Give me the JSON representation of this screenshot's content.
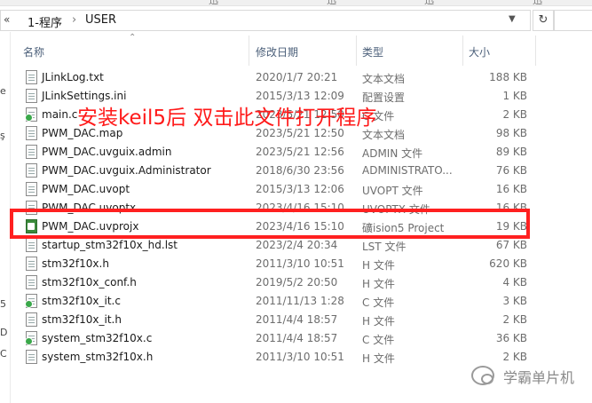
{
  "window": {
    "top_strip": [
      "迅",
      "迅",
      "迅",
      "迅"
    ]
  },
  "address_bar": {
    "overflow": "«",
    "crumbs": [
      "1-程序",
      "USER"
    ],
    "separator": "›"
  },
  "columns": {
    "name": "名称",
    "modified": "修改日期",
    "type": "类型",
    "size": "大小"
  },
  "files": [
    {
      "name": "JLinkLog.txt",
      "date": "2020/1/7 20:21",
      "type": "文本文档",
      "size": "188 KB",
      "icon": "text-file-icon"
    },
    {
      "name": "JLinkSettings.ini",
      "date": "2015/3/13 12:09",
      "type": "配置设置",
      "size": "1 KB",
      "icon": "settings-file-icon"
    },
    {
      "name": "main.c",
      "date": "2023/5/21 12:50",
      "type": "C 文件",
      "size": "2 KB",
      "icon": "c-file-icon"
    },
    {
      "name": "PWM_DAC.map",
      "date": "2023/5/21 12:50",
      "type": "文本文档",
      "size": "98 KB",
      "icon": "text-file-icon"
    },
    {
      "name": "PWM_DAC.uvguix.admin",
      "date": "2023/5/21 12:56",
      "type": "ADMIN 文件",
      "size": "89 KB",
      "icon": "generic-file-icon"
    },
    {
      "name": "PWM_DAC.uvguix.Administrator",
      "date": "2018/6/30 23:56",
      "type": "ADMINISTRATO...",
      "size": "76 KB",
      "icon": "generic-file-icon"
    },
    {
      "name": "PWM_DAC.uvopt",
      "date": "2015/3/13 12:06",
      "type": "UVOPT 文件",
      "size": "16 KB",
      "icon": "generic-file-icon"
    },
    {
      "name": "PWM_DAC.uvoptx",
      "date": "2023/4/16 15:10",
      "type": "UVOPTX 文件",
      "size": "16 KB",
      "icon": "generic-file-icon"
    },
    {
      "name": "PWM_DAC.uvprojx",
      "date": "2023/4/16 15:10",
      "type": "礦ision5 Project",
      "size": "19 KB",
      "icon": "keil-project-icon"
    },
    {
      "name": "startup_stm32f10x_hd.lst",
      "date": "2023/2/4 20:34",
      "type": "LST 文件",
      "size": "67 KB",
      "icon": "generic-file-icon"
    },
    {
      "name": "stm32f10x.h",
      "date": "2011/3/10 10:51",
      "type": "H 文件",
      "size": "620 KB",
      "icon": "h-file-icon"
    },
    {
      "name": "stm32f10x_conf.h",
      "date": "2019/5/2 20:50",
      "type": "H 文件",
      "size": "4 KB",
      "icon": "h-file-icon"
    },
    {
      "name": "stm32f10x_it.c",
      "date": "2011/11/13 1:28",
      "type": "C 文件",
      "size": "3 KB",
      "icon": "c-file-icon"
    },
    {
      "name": "stm32f10x_it.h",
      "date": "2011/4/4 18:57",
      "type": "H 文件",
      "size": "2 KB",
      "icon": "h-file-icon"
    },
    {
      "name": "system_stm32f10x.c",
      "date": "2011/4/4 18:57",
      "type": "C 文件",
      "size": "36 KB",
      "icon": "c-file-icon"
    },
    {
      "name": "system_stm32f10x.h",
      "date": "2011/3/10 10:51",
      "type": "H 文件",
      "size": "2 KB",
      "icon": "h-file-icon"
    }
  ],
  "annotation": {
    "text": "安装keil5后 双击此文件打开程序",
    "color": "#ff1a1a"
  },
  "highlight_color": "#ff2020",
  "nav_pane_glyphs": [
    "e",
    "ş",
    "5",
    "D",
    "C"
  ],
  "watermark": {
    "text": "学霸单片机"
  }
}
